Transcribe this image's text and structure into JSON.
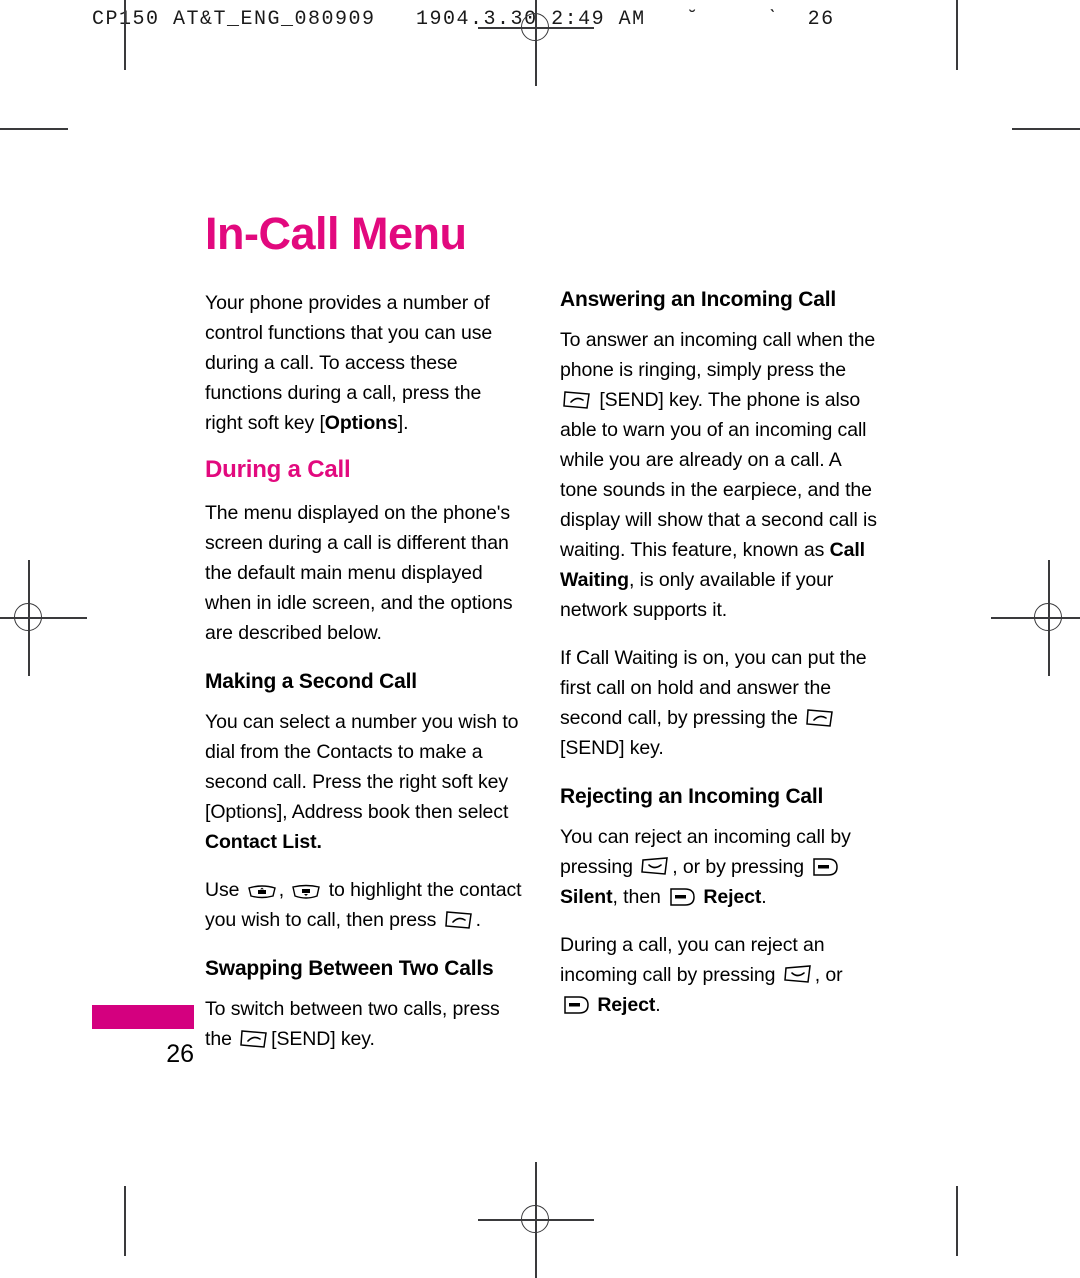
{
  "printer": {
    "header_line": "CP150 AT&T_ENG_080909   1904.3.30 2:49 AM   ˘     ˋ  26"
  },
  "page": {
    "title": "In-Call Menu",
    "number": "26",
    "accent_color": "#e2097e",
    "tab_color": "#d4007f"
  },
  "left_column": {
    "intro": {
      "before_bold": "Your phone provides a number of control functions that you can use during a call. To access these functions during a call, press the right soft key [",
      "bold": "Options",
      "after_bold": "]."
    },
    "section_heading": "During a Call",
    "during_a_call_text": "The menu displayed on the phone's screen during a call is different than the default main menu displayed when in idle screen, and the options are described below.",
    "making_second_call": {
      "heading": "Making a Second Call",
      "paragraph_before_bold": "You can select a number you wish to dial from the Contacts to make a second call. Press the right soft key [Options], Address book then select ",
      "paragraph_bold": "Contact List.",
      "use_line_1": "Use",
      "use_line_comma": ",",
      "use_line_2": "to highlight the contact you wish to call, then press",
      "use_line_3": "."
    },
    "swapping": {
      "heading": "Swapping Between Two Calls",
      "text_before_icon": "To switch between two calls, press the",
      "text_after_icon": "[SEND] key."
    }
  },
  "right_column": {
    "answering": {
      "heading": "Answering an Incoming Call",
      "para1_part1": "To answer an incoming call when the phone is ringing, simply press the",
      "para1_part2_before_bold": "[SEND] key. The phone is also able to warn you of an incoming call while you are already on a call. A tone sounds in the earpiece, and the display will show that a second call is waiting. This feature, known as ",
      "para1_bold": "Call Waiting",
      "para1_after_bold": ", is only available if your network supports it.",
      "para2_part1": "If Call Waiting is on, you can put the first call on hold and answer the second call, by pressing the",
      "para2_part2": "[SEND] key."
    },
    "rejecting": {
      "heading": "Rejecting an Incoming Call",
      "para1_part1": "You can reject an incoming call by pressing",
      "para1_part2": ", or by pressing",
      "para1_bold1": "Silent",
      "para1_part3": ", then",
      "para1_bold2": "Reject",
      "para1_part4": ".",
      "para2_part1": "During a call, you can reject an incoming call by pressing",
      "para2_part2": ", or",
      "para2_bold": "Reject",
      "para2_part3": "."
    }
  },
  "icons": {
    "send_key": "send-key-icon",
    "end_key": "end-key-icon",
    "soft_key": "right-soft-key-icon",
    "nav_up_key": "nav-up-key-icon",
    "nav_down_key": "nav-down-key-icon"
  }
}
